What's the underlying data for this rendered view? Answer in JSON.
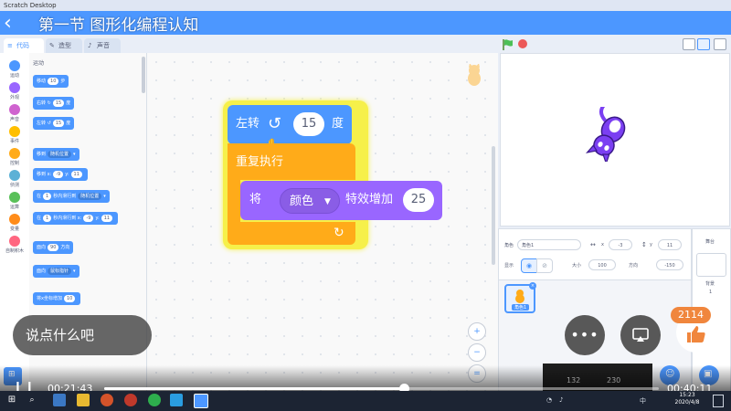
{
  "window": {
    "title": "Scratch Desktop"
  },
  "video": {
    "title": "第一节 图形化编程认知",
    "back_icon": "back-arrow-icon"
  },
  "tabs": [
    {
      "label": "代码",
      "icon": "code-icon"
    },
    {
      "label": "造型",
      "icon": "brush-icon"
    },
    {
      "label": "声音",
      "icon": "sound-icon"
    }
  ],
  "categories": [
    {
      "label": "运动",
      "color": "#4c97ff"
    },
    {
      "label": "外观",
      "color": "#9966ff"
    },
    {
      "label": "声音",
      "color": "#cf63cf"
    },
    {
      "label": "事件",
      "color": "#ffbf00"
    },
    {
      "label": "控制",
      "color": "#ffab19"
    },
    {
      "label": "侦测",
      "color": "#5cb1d6"
    },
    {
      "label": "运算",
      "color": "#59c059"
    },
    {
      "label": "变量",
      "color": "#ff8c1a"
    },
    {
      "label": "自制积木",
      "color": "#ff6680"
    }
  ],
  "palette": {
    "section": "运动",
    "move": {
      "a": "移动",
      "v": "10",
      "b": "步"
    },
    "turn_right": {
      "a": "右转",
      "v": "15",
      "b": "度"
    },
    "turn_left": {
      "a": "左转",
      "v": "15",
      "b": "度"
    },
    "goto": {
      "a": "移到",
      "opt": "随机位置"
    },
    "goto_xy": {
      "a": "移到 x:",
      "x": "-9",
      "b": "y:",
      "y": "11"
    },
    "glide": {
      "a": "在",
      "v": "1",
      "b": "秒内滑行到",
      "opt": "随机位置"
    },
    "glide_xy": {
      "a": "在",
      "v": "1",
      "b": "秒内滑行到 x:",
      "x": "-9",
      "c": "y:",
      "y": "11"
    },
    "point_dir": {
      "a": "面向",
      "v": "90",
      "b": "方向"
    },
    "point_towards": {
      "a": "面向",
      "opt": "鼠标指针"
    },
    "change_x": {
      "a": "将x坐标增加",
      "v": "10"
    }
  },
  "script": {
    "turn": {
      "label": "左转",
      "value": "15",
      "unit": "度"
    },
    "repeat": {
      "label": "重复执行"
    },
    "effect": {
      "label_a": "将",
      "dropdown": "颜色",
      "label_b": "特效增加",
      "value": "25"
    }
  },
  "zoom": {
    "in": "+",
    "out": "−",
    "reset": "="
  },
  "sprite_info": {
    "sprite_label": "角色",
    "sprite_name": "角色1",
    "x_label": "x",
    "x": "-3",
    "y_label": "y",
    "y": "11",
    "show_label": "显示",
    "size_label": "大小",
    "size": "100",
    "dir_label": "方向",
    "dir": "-150"
  },
  "sprite_list": [
    {
      "name": "角色1"
    }
  ],
  "backdrop": {
    "title": "舞台",
    "label": "背景",
    "count": "1"
  },
  "readout": {
    "x": "132",
    "y": "230"
  },
  "overlay": {
    "chat_placeholder": "说点什么吧",
    "more_icon": "more-icon",
    "cast_icon": "cast-icon",
    "like_icon": "thumbs-up-icon",
    "like_count": "2114"
  },
  "player": {
    "current_time": "00:21:43",
    "total_time": "00:40:11",
    "progress": 0.54
  },
  "taskbar": {
    "time": "15:23",
    "date": "2020/4/8",
    "ime": "中"
  }
}
